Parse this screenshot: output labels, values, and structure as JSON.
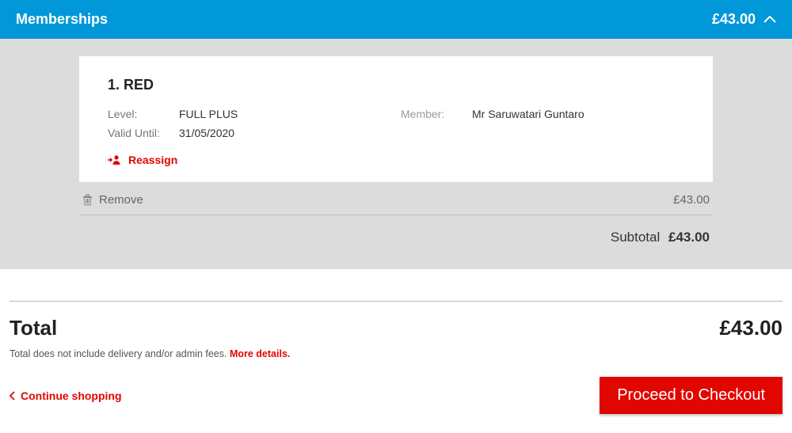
{
  "panel": {
    "title": "Memberships",
    "header_amount": "£43.00"
  },
  "item": {
    "title": "1. RED",
    "level_label": "Level:",
    "level_value": "FULL PLUS",
    "member_label": "Member:",
    "member_value": "Mr Saruwatari Guntaro",
    "valid_label": "Valid Until:",
    "valid_value": "31/05/2020",
    "reassign_label": "Reassign",
    "remove_label": "Remove",
    "price": "£43.00"
  },
  "subtotal": {
    "label": "Subtotal",
    "amount": "£43.00"
  },
  "total": {
    "label": "Total",
    "amount": "£43.00",
    "note_text": "Total does not include delivery and/or admin fees. ",
    "more_details": "More details."
  },
  "footer": {
    "continue_label": "Continue shopping",
    "checkout_label": "Proceed to Checkout"
  }
}
